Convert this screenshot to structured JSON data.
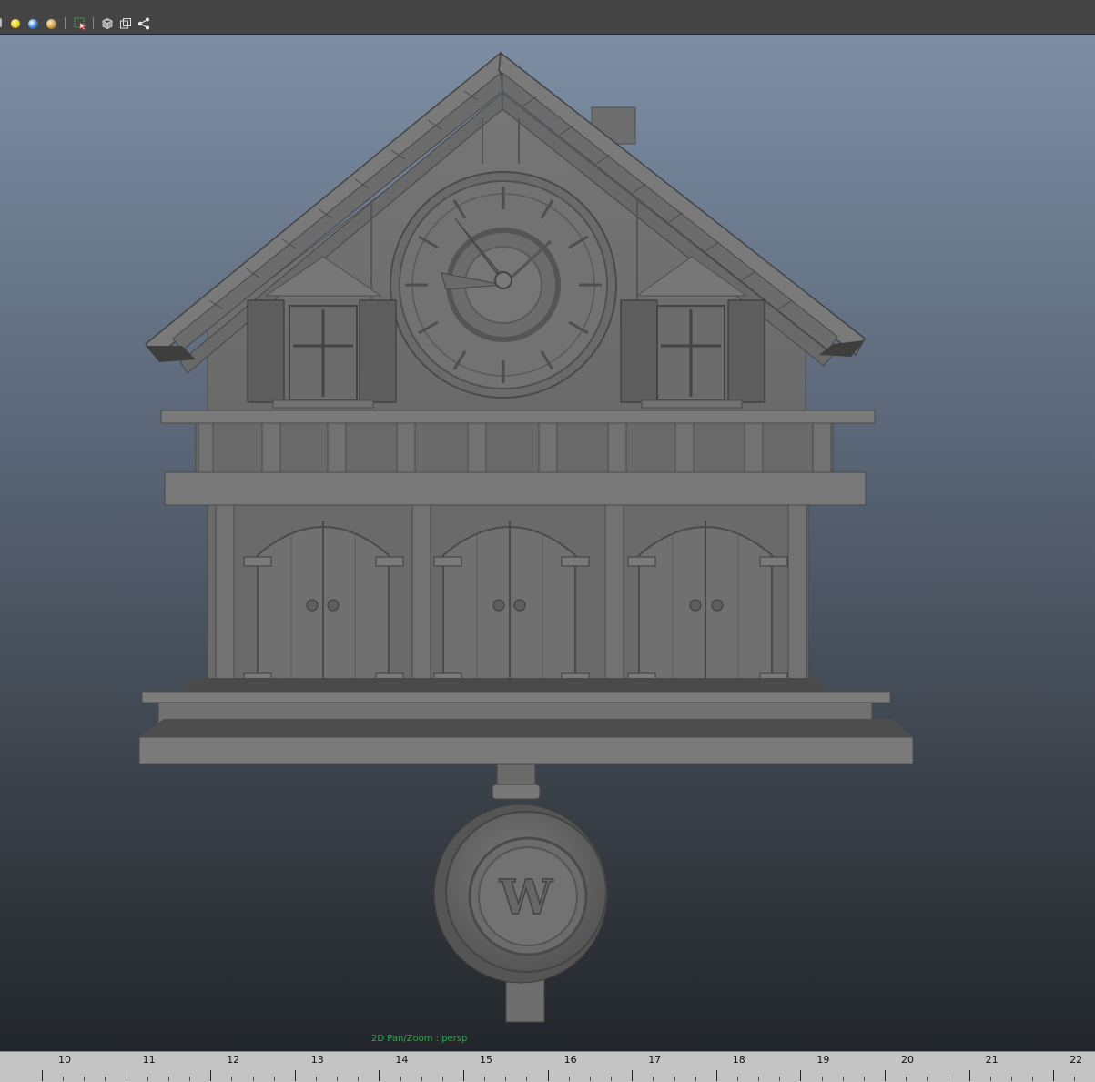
{
  "toolbar": {
    "icons": [
      "light-yellow-icon",
      "sphere-blue-icon",
      "sphere-gold-icon",
      "select-camera-icon",
      "wireframe-cube-icon",
      "xray-icon",
      "share-graph-icon"
    ],
    "colors": {
      "bg": "#444444",
      "yellow": "#e8d020",
      "blue": "#3a7fd0",
      "gold": "#c99a40"
    }
  },
  "viewport": {
    "hud_text": "2D Pan/Zoom : persp",
    "model_emblem": "W",
    "colors": {
      "hud": "#2fa84a",
      "model": "#6f6f6f"
    }
  },
  "timeline": {
    "ticks": [
      "10",
      "11",
      "12",
      "13",
      "14",
      "15",
      "16",
      "17",
      "18",
      "19",
      "20",
      "21",
      "22"
    ]
  }
}
